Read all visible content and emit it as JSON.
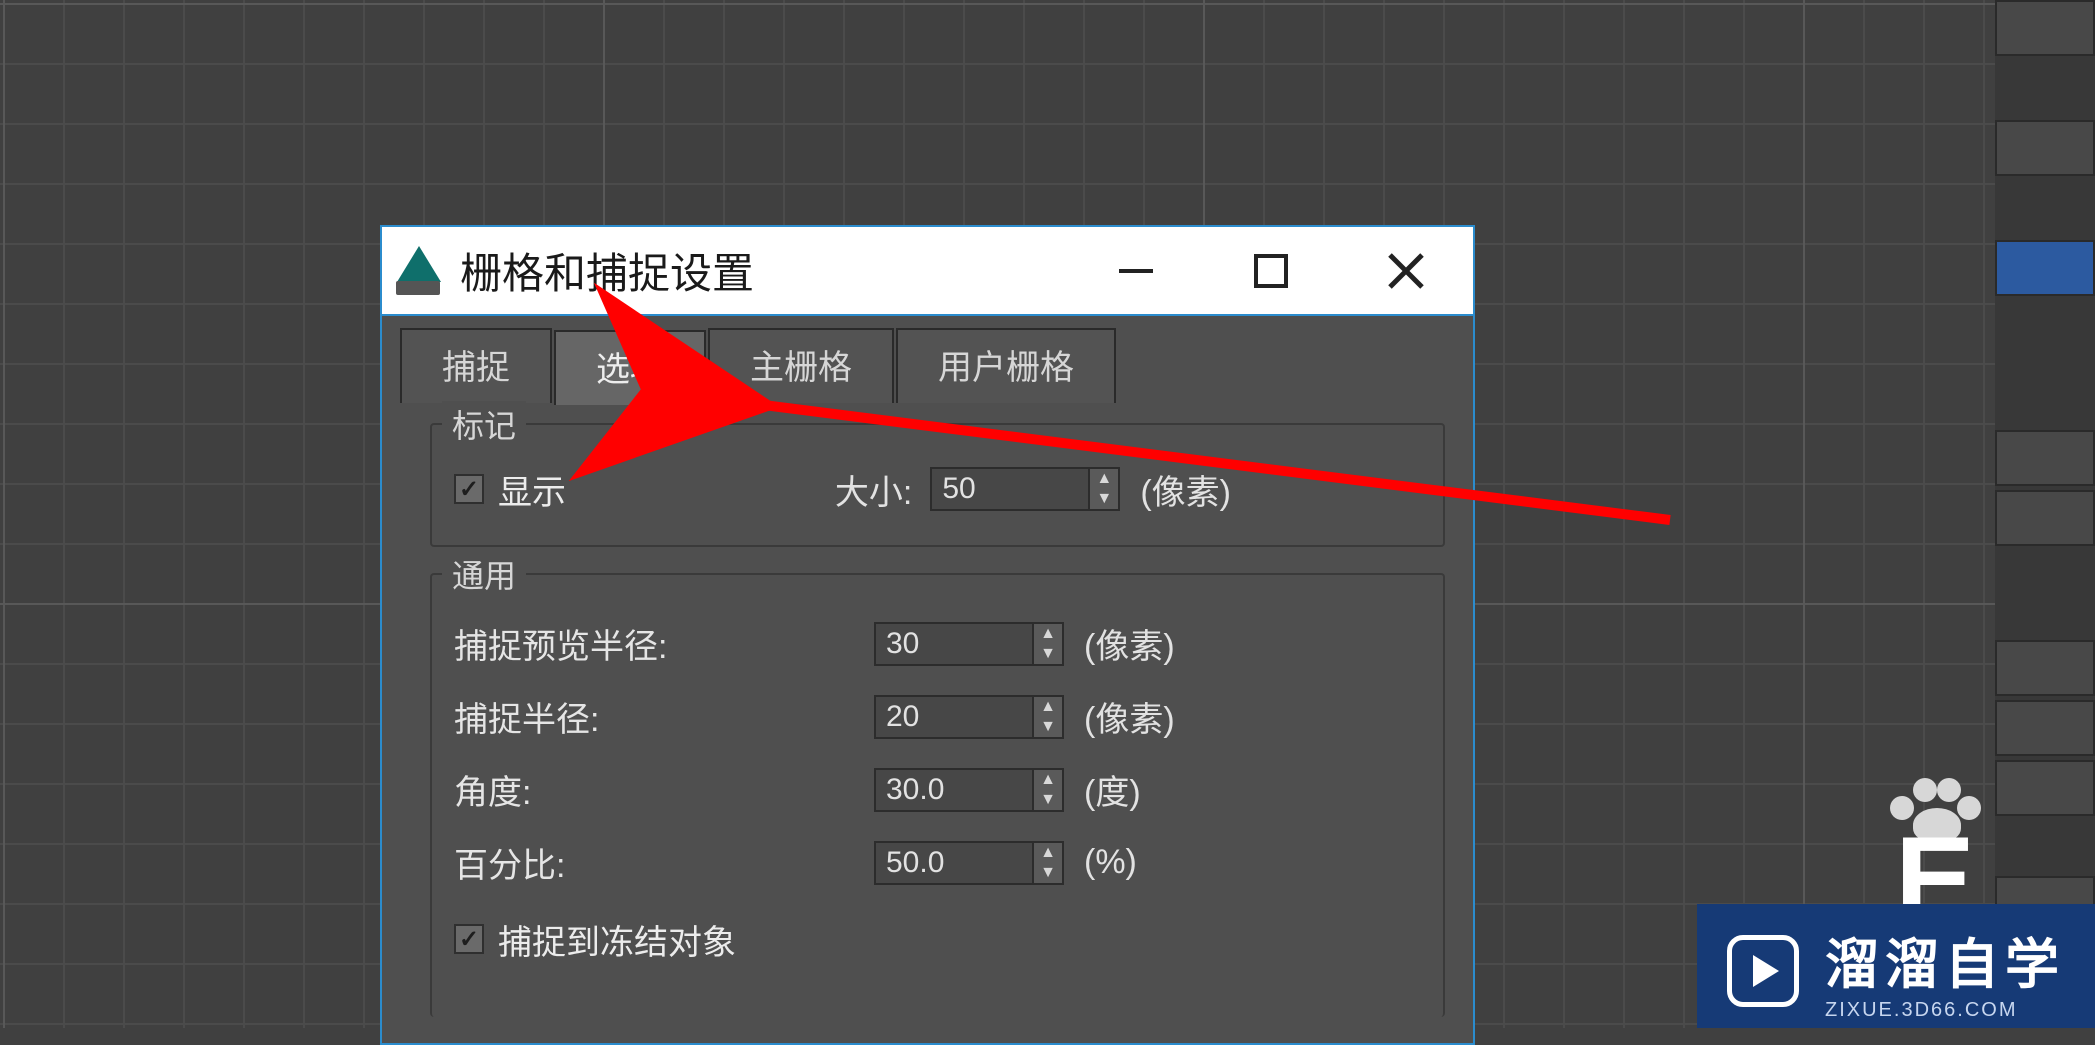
{
  "dialog": {
    "title": "栅格和捕捉设置",
    "tabs": [
      "捕捉",
      "选项",
      "主栅格",
      "用户栅格"
    ],
    "active_tab": 1,
    "groups": {
      "mark": {
        "legend": "标记",
        "show_checkbox": {
          "label": "显示",
          "checked": true
        },
        "size": {
          "label": "大小:",
          "value": "50",
          "unit": "(像素)"
        }
      },
      "general": {
        "legend": "通用",
        "rows": [
          {
            "label": "捕捉预览半径:",
            "value": "30",
            "unit": "(像素)"
          },
          {
            "label": "捕捉半径:",
            "value": "20",
            "unit": "(像素)"
          },
          {
            "label": "角度:",
            "value": "30.0",
            "unit": "(度)"
          },
          {
            "label": "百分比:",
            "value": "50.0",
            "unit": "(%)"
          }
        ],
        "snap_frozen": {
          "label": "捕捉到冻结对象",
          "checked": true
        }
      }
    }
  },
  "watermark": {
    "main": "溜溜自学",
    "sub": "ZIXUE.3D66.COM"
  }
}
